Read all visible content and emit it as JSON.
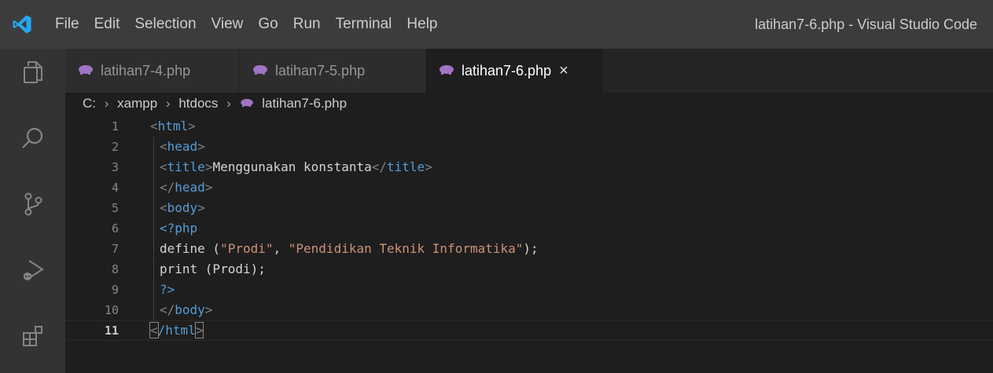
{
  "window_title": "latihan7-6.php - Visual Studio Code",
  "menu": [
    "File",
    "Edit",
    "Selection",
    "View",
    "Go",
    "Run",
    "Terminal",
    "Help"
  ],
  "tabs": [
    {
      "label": "latihan7-4.php"
    },
    {
      "label": "latihan7-5.php"
    },
    {
      "label": "latihan7-6.php",
      "close": "×"
    }
  ],
  "breadcrumb": {
    "items": [
      "C:",
      "xampp",
      "htdocs",
      "latihan7-6.php"
    ],
    "separator": "›"
  },
  "editor": {
    "line_numbers": [
      "1",
      "2",
      "3",
      "4",
      "5",
      "6",
      "7",
      "8",
      "9",
      "10",
      "11"
    ],
    "lines": [
      {
        "a": "<",
        "b": "html",
        "c": ">"
      },
      {
        "a": "<",
        "b": "head",
        "c": ">"
      },
      {
        "a": "<",
        "b": "title",
        "c": ">",
        "d": "Menggunakan konstanta",
        "e": "</",
        "f": "title",
        "g": ">"
      },
      {
        "a": "</",
        "b": "head",
        "c": ">"
      },
      {
        "a": "<",
        "b": "body",
        "c": ">"
      },
      {
        "a": "<?php"
      },
      {
        "a": "define (",
        "b": "\"Prodi\"",
        "c": ", ",
        "d": "\"Pendidikan Teknik Informatika\"",
        "e": ");"
      },
      {
        "a": "print (Prodi);"
      },
      {
        "a": "?>"
      },
      {
        "a": "</",
        "b": "body",
        "c": ">"
      },
      {
        "a": "<",
        "b": "/html",
        "c": ">"
      }
    ]
  },
  "colors": {
    "titlebar": "#3c3c3c",
    "activity_bar": "#333333",
    "editor_bg": "#1e1e1e",
    "tag": "#569cd6",
    "string": "#ce9178",
    "php_icon": "#a074c4",
    "vscode_blue": "#23a9f2"
  },
  "icons": {
    "activity_bar": [
      "explorer-icon",
      "search-icon",
      "source-control-icon",
      "run-debug-icon",
      "extensions-icon"
    ],
    "tab_file": "php-elephant-icon",
    "logo": "vscode-logo-icon"
  }
}
